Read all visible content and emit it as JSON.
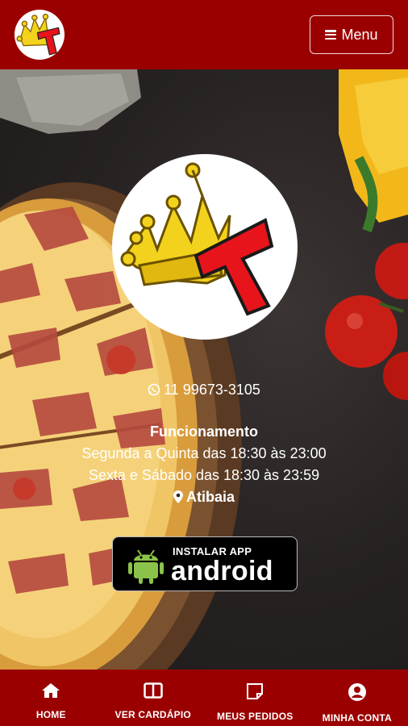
{
  "header": {
    "logo_alt": "logo",
    "menu_label": "Menu",
    "menu_icon": "bars-icon"
  },
  "store": {
    "phone": "11 99673-3105",
    "phone_icon": "whatsapp-icon",
    "hours_title": "Funcionamento",
    "hours": [
      "Segunda a Quinta das 18:30 às 23:00",
      "Sexta e Sábado das 18:30 às 23:59"
    ],
    "city": "Atibaia",
    "city_icon": "map-marker-icon"
  },
  "install_app": {
    "line1": "INSTALAR APP",
    "line2": "android"
  },
  "bottom_nav": {
    "items": [
      {
        "label": "HOME",
        "icon": "home-icon"
      },
      {
        "label": "VER CARDÁPIO",
        "icon": "book-icon"
      },
      {
        "label": "MEUS PEDIDOS",
        "icon": "note-icon"
      },
      {
        "label": "MINHA CONTA",
        "icon": "user-circle-icon"
      }
    ]
  },
  "colors": {
    "brand_red": "#9b0000",
    "logo_red": "#e8141b",
    "crown_gold": "#f2d21c",
    "android_green": "#8bc34a"
  }
}
